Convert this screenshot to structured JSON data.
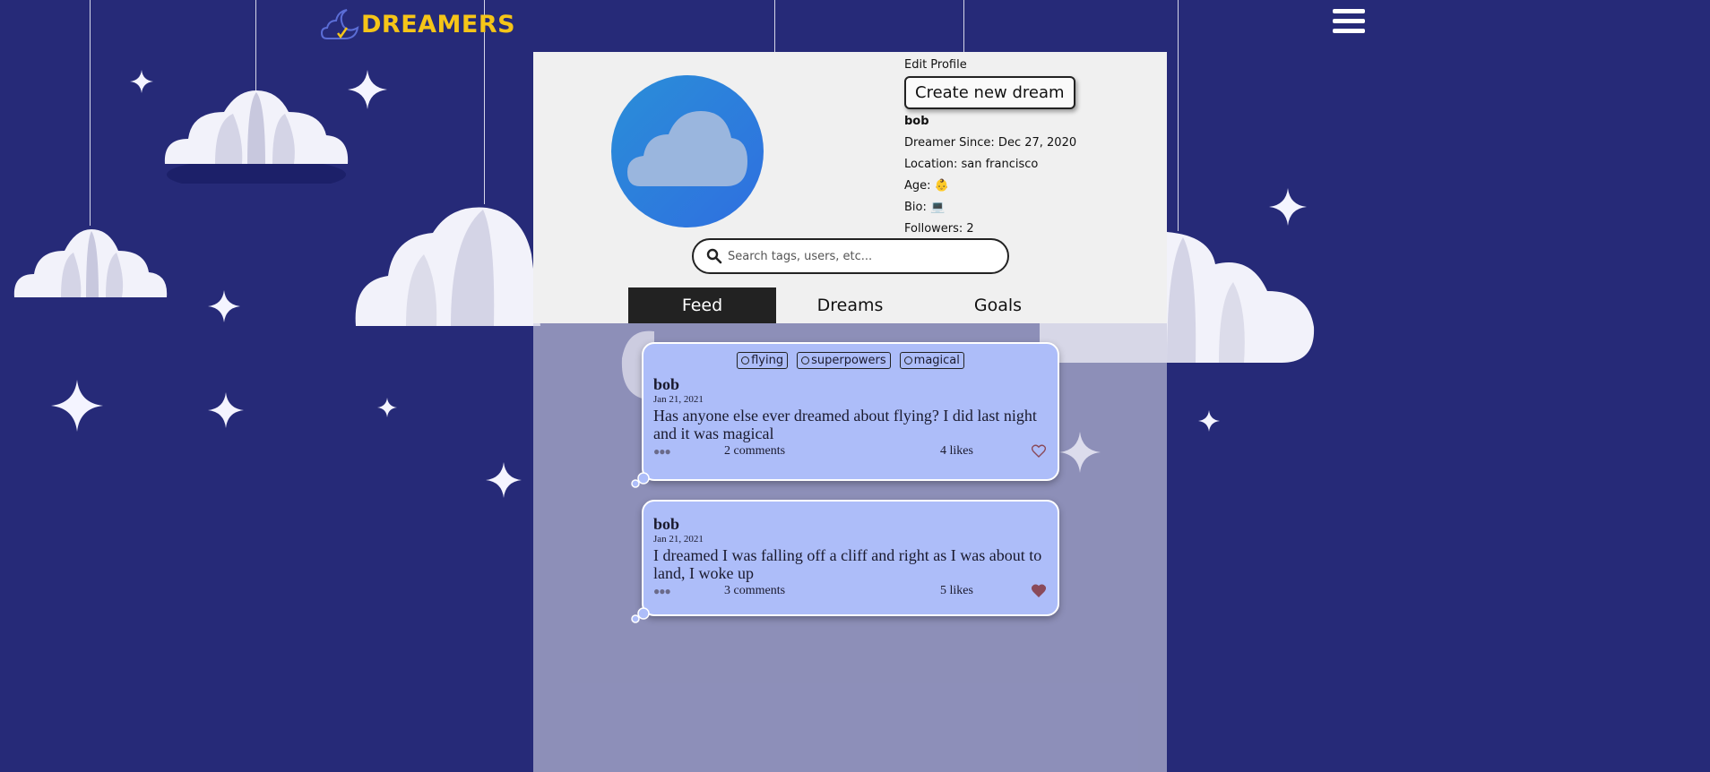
{
  "brand": {
    "name": "DREAMERS",
    "color": "#f5c518"
  },
  "header": {
    "menu_icon": "hamburger-icon"
  },
  "profile": {
    "edit_label": "Edit Profile",
    "create_label": "Create new dream",
    "username": "bob",
    "since": "Dreamer Since: Dec 27, 2020",
    "location": "Location: san francisco",
    "age_label": "Age:",
    "age_emoji": "👶",
    "bio_label": "Bio:",
    "bio_emoji": "💻",
    "followers": "Followers: 2",
    "avatar_icon": "cloud-icon"
  },
  "search": {
    "placeholder": "Search tags, users, etc..."
  },
  "tabs": [
    {
      "label": "Feed",
      "active": true
    },
    {
      "label": "Dreams",
      "active": false
    },
    {
      "label": "Goals",
      "active": false
    }
  ],
  "posts": [
    {
      "tags": [
        "flying",
        "superpowers",
        "magical"
      ],
      "user": "bob",
      "date": "Jan 21, 2021",
      "text": "Has anyone else ever dreamed about flying? I did last night and it was magical",
      "comments": "2 comments",
      "likes": "4 likes",
      "liked": false
    },
    {
      "tags": [],
      "user": "bob",
      "date": "Jan 21, 2021",
      "text": "I dreamed I was falling off a cliff and right as I was about to land, I woke up",
      "comments": "3 comments",
      "likes": "5 likes",
      "liked": true
    }
  ],
  "colors": {
    "background": "#262a78",
    "post": "#adbdf9",
    "heart": "#8a4a5a",
    "active_tab": "#222222"
  }
}
